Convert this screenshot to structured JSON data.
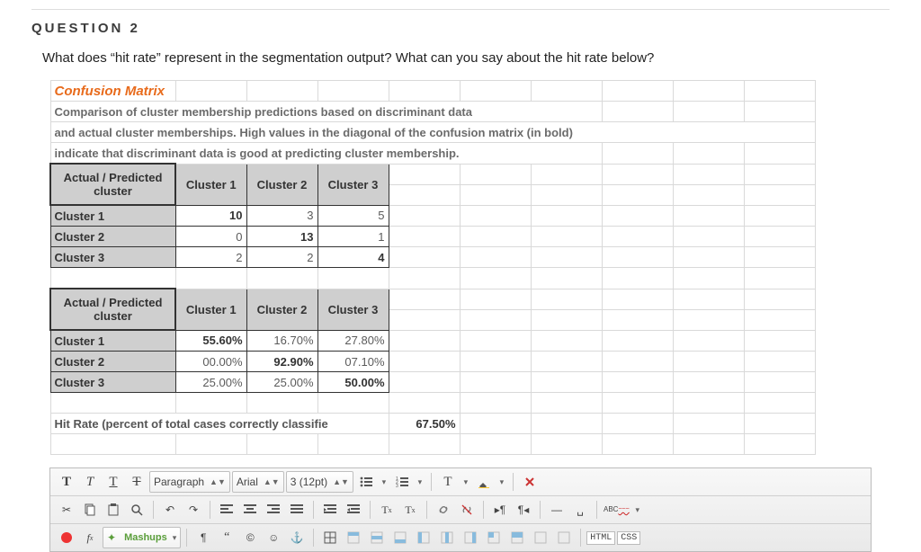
{
  "question": {
    "label": "QUESTION 2",
    "prompt": "What does “hit rate” represent in the segmentation output? What can you say about the hit rate below?"
  },
  "confusion": {
    "title": "Confusion Matrix",
    "desc1": "Comparison of cluster membership predictions based on discriminant data",
    "desc2": "and actual cluster memberships. High values in the diagonal of the confusion matrix (in bold)",
    "desc3": "indicate that discriminant data is good at predicting cluster membership.",
    "header_ap_top": "Actual / Predicted",
    "header_ap_bot": "cluster",
    "cols": [
      "Cluster 1",
      "Cluster 2",
      "Cluster 3"
    ],
    "rows": [
      "Cluster 1",
      "Cluster 2",
      "Cluster 3"
    ],
    "counts": [
      [
        "10",
        "3",
        "5"
      ],
      [
        "0",
        "13",
        "1"
      ],
      [
        "2",
        "2",
        "4"
      ]
    ],
    "pcts": [
      [
        "55.60%",
        "16.70%",
        "27.80%"
      ],
      [
        "00.00%",
        "92.90%",
        "07.10%"
      ],
      [
        "25.00%",
        "25.00%",
        "50.00%"
      ]
    ],
    "hit_label": "Hit Rate (percent of total cases correctly classifie",
    "hit_value": "67.50%"
  },
  "toolbar": {
    "para": "Paragraph",
    "font": "Arial",
    "size": "3 (12pt)",
    "mashups": "Mashups",
    "html": "HTML",
    "css": "CSS"
  },
  "chart_data": [
    {
      "type": "table",
      "title": "Confusion Matrix (counts)",
      "row_labels": [
        "Cluster 1",
        "Cluster 2",
        "Cluster 3"
      ],
      "col_labels": [
        "Cluster 1",
        "Cluster 2",
        "Cluster 3"
      ],
      "values": [
        [
          10,
          3,
          5
        ],
        [
          0,
          13,
          1
        ],
        [
          2,
          2,
          4
        ]
      ]
    },
    {
      "type": "table",
      "title": "Confusion Matrix (percentages)",
      "row_labels": [
        "Cluster 1",
        "Cluster 2",
        "Cluster 3"
      ],
      "col_labels": [
        "Cluster 1",
        "Cluster 2",
        "Cluster 3"
      ],
      "values": [
        [
          55.6,
          16.7,
          27.8
        ],
        [
          0.0,
          92.9,
          7.1
        ],
        [
          25.0,
          25.0,
          50.0
        ]
      ],
      "unit": "percent"
    },
    {
      "type": "table",
      "title": "Hit Rate",
      "values": [
        [
          67.5
        ]
      ],
      "unit": "percent"
    }
  ]
}
